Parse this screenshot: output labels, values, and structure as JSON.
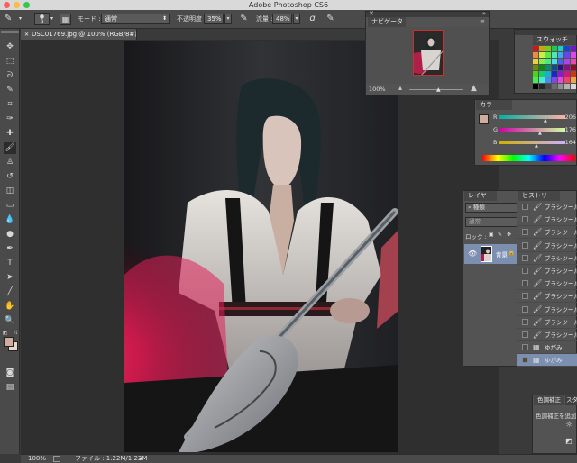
{
  "window": {
    "title": "Adobe Photoshop CS6"
  },
  "options": {
    "brush_size": "9",
    "mode_label": "モード :",
    "mode_value": "通常",
    "opacity_label": "不透明度 :",
    "opacity_value": "35%",
    "flow_label": "流量 :",
    "flow_value": "48%"
  },
  "document": {
    "tab_label": "DSC01769.jpg @ 100% (RGB/8#) *"
  },
  "status": {
    "zoom": "100%",
    "file_info": "ファイル : 1.22M/1.22M"
  },
  "navigator": {
    "title": "ナビゲーター",
    "zoom": "100%"
  },
  "swatches": {
    "title": "スウォッチ"
  },
  "color": {
    "title": "カラー",
    "channels": [
      {
        "label": "R",
        "value": "206"
      },
      {
        "label": "G",
        "value": "176"
      },
      {
        "label": "B",
        "value": "164"
      }
    ]
  },
  "layers": {
    "title": "レイヤー",
    "kind_label": "種類",
    "blend_mode": "通常",
    "lock_label": "ロック :",
    "items": [
      {
        "name": "背景"
      }
    ]
  },
  "history": {
    "title": "ヒストリー",
    "items": [
      {
        "label": "ブラシツール",
        "icon": "brush"
      },
      {
        "label": "ブラシツール",
        "icon": "brush"
      },
      {
        "label": "ブラシツール",
        "icon": "brush"
      },
      {
        "label": "ブラシツール",
        "icon": "brush"
      },
      {
        "label": "ブラシツール",
        "icon": "brush"
      },
      {
        "label": "ブラシツール",
        "icon": "brush"
      },
      {
        "label": "ブラシツール",
        "icon": "brush"
      },
      {
        "label": "ブラシツール",
        "icon": "brush"
      },
      {
        "label": "ブラシツール",
        "icon": "brush"
      },
      {
        "label": "ブラシツール",
        "icon": "brush"
      },
      {
        "label": "ブラシツール",
        "icon": "brush"
      },
      {
        "label": "ゆがみ",
        "icon": "liquify"
      },
      {
        "label": "ゆがみ",
        "icon": "liquify"
      }
    ]
  },
  "adjustments": {
    "title": "色調補正",
    "title2": "スタ",
    "subtitle": "色調補正を追加"
  },
  "colors": {
    "foreground": "#cfae9e",
    "background": "#e9d6cb",
    "selection": "#7c8fb0"
  }
}
